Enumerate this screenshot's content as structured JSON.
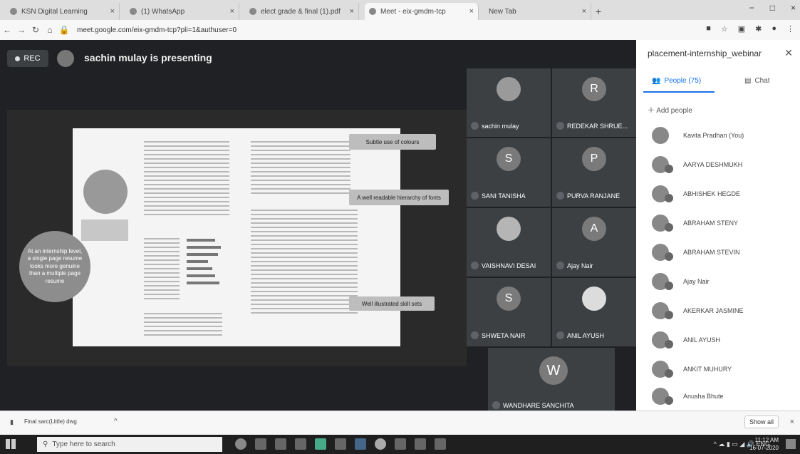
{
  "browser": {
    "tabs": [
      {
        "label": "KSN Digital Learning",
        "active": false
      },
      {
        "label": "(1) WhatsApp",
        "active": false
      },
      {
        "label": "elect grade & final (1).pdf",
        "active": false
      },
      {
        "label": "Meet - eix-gmdm-tcp",
        "active": true
      },
      {
        "label": "New Tab",
        "active": false
      }
    ],
    "new_tab": "+",
    "window_controls": [
      "−",
      "□",
      "×"
    ],
    "url": "meet.google.com/eix-gmdm-tcp?pli=1&authuser=0"
  },
  "meet": {
    "rec_label": "REC",
    "presenting_text": "sachin mulay is presenting",
    "slide": {
      "callouts": [
        "Subtle use of colours",
        "A well readable hierarchy of fonts",
        "Well illustrated skill sets"
      ],
      "circle_note": "At an internship level, a single page resume looks more genuine than a multiple page resume"
    },
    "participants": [
      {
        "name": "sachin mulay",
        "initial": ""
      },
      {
        "name": "REDEKAR SHRUE...",
        "initial": "R"
      },
      {
        "name": "SANI TANISHA",
        "initial": "S"
      },
      {
        "name": "PURVA RANJANE",
        "initial": "P"
      },
      {
        "name": "VAISHNAVI DESAI",
        "initial": ""
      },
      {
        "name": "Ajay Nair",
        "initial": "A"
      },
      {
        "name": "SHWETA NAIR",
        "initial": "S"
      },
      {
        "name": "ANIL AYUSH",
        "initial": ""
      },
      {
        "name": "WANDHARE SANCHITA",
        "initial": "W"
      }
    ]
  },
  "panel": {
    "title": "placement-internship_webinar",
    "people_tab": "People (75)",
    "chat_tab": "Chat",
    "add_people": "Add people",
    "people": [
      "Kavita Pradhan (You)",
      "AARYA DESHMUKH",
      "ABHISHEK HEGDE",
      "ABRAHAM STENY",
      "ABRAHAM STEVIN",
      "Ajay Nair",
      "AKERKAR JASMINE",
      "ANIL AYUSH",
      "ANKIT MUHURY",
      "Anusha Bhute"
    ]
  },
  "downloads": {
    "item": "Final sarc(Little) dwg",
    "show_all": "Show all",
    "close": "×"
  },
  "taskbar": {
    "search_placeholder": "Type here to search",
    "lang": "ENG",
    "time": "11:12 AM",
    "date": "16-07-2020"
  }
}
